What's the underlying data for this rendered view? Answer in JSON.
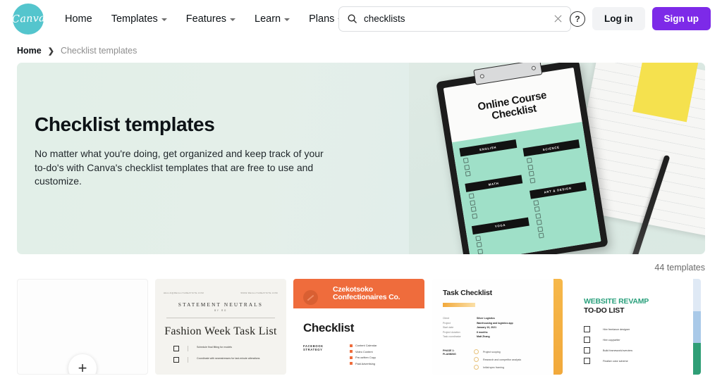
{
  "header": {
    "logo_text": "Canva",
    "nav": [
      {
        "label": "Home",
        "has_caret": false
      },
      {
        "label": "Templates",
        "has_caret": true
      },
      {
        "label": "Features",
        "has_caret": true
      },
      {
        "label": "Learn",
        "has_caret": true
      },
      {
        "label": "Plans",
        "has_caret": true
      }
    ],
    "search": {
      "value": "checklists",
      "placeholder": "Search",
      "clear_label": "×"
    },
    "help_label": "?",
    "login_label": "Log in",
    "signup_label": "Sign up",
    "signup_color": "#7d2ae8",
    "logo_color": "#54c5cd"
  },
  "breadcrumb": {
    "home": "Home",
    "separator": "›",
    "current": "Checklist templates"
  },
  "hero": {
    "title": "Checklist templates",
    "description": "No matter what you're doing, get organized and keep track of your to-do's with Canva's checklist templates that are free to use and customize.",
    "background_color": "#e3efe9",
    "photo": {
      "clipboard_title": "Online Course Checklist",
      "sections_left": [
        "ENGLISH",
        "MATH",
        "YOGA"
      ],
      "sections_right": [
        "SCIENCE",
        "ART & DESIGN"
      ],
      "sheet_color": "#9fe0c8",
      "sticky_note_color": "#f5e14e"
    }
  },
  "results": {
    "count_label": "44 templates"
  },
  "templates": [
    {
      "id": "blank",
      "type": "create-blank",
      "plus_label": "+"
    },
    {
      "id": "fashion-week-task-list",
      "type": "template-preview",
      "email": "HELLO@REALLYGREATSITE.COM",
      "website": "WWW.REALLYGREATSITE.COM",
      "brand": "STATEMENT NEUTRALS",
      "by_line": "BY  RG",
      "title": "Fashion Week Task List",
      "items": [
        "Schedule final fitting for models",
        "Coordinate with seamstresses for last-minute alterations"
      ]
    },
    {
      "id": "czekotsoko-checklist",
      "type": "template-preview",
      "company_line1": "Czekotsoko",
      "company_line2": "Confectionaires Co.",
      "title": "Checklist",
      "section_label": "FACEBOOK STRATEGY",
      "items": [
        "Content Calendar",
        "Video Content",
        "Pre-written Copy",
        "Paid Advertising"
      ],
      "accent_color": "#ef6c3c"
    },
    {
      "id": "task-checklist",
      "type": "template-preview",
      "title": "Task Checklist",
      "fields": [
        {
          "key": "Client",
          "value": "Silver Logistics"
        },
        {
          "key": "Project",
          "value": "Warehousing and logistics app"
        },
        {
          "key": "Start date",
          "value": "January 10, 2021"
        },
        {
          "key": "Project duration",
          "value": "6 months"
        },
        {
          "key": "Task coordinator",
          "value": "Matt Zhang"
        }
      ],
      "phase_label": "PHASE 1: PLANNING",
      "phase_items": [
        "Project scoping",
        "Research and competitor analysis",
        "Initial spec framing"
      ],
      "accent_color": "#f2a93b"
    },
    {
      "id": "website-revamp-todo",
      "type": "template-preview",
      "title_line1": "WEBSITE REVAMP",
      "title_line2": "TO-DO LIST",
      "items": [
        "Hire freelance designer",
        "Hire copywriter",
        "Build framework/overview",
        "Finalize color scheme"
      ],
      "accent_color": "#2aa07c"
    }
  ]
}
